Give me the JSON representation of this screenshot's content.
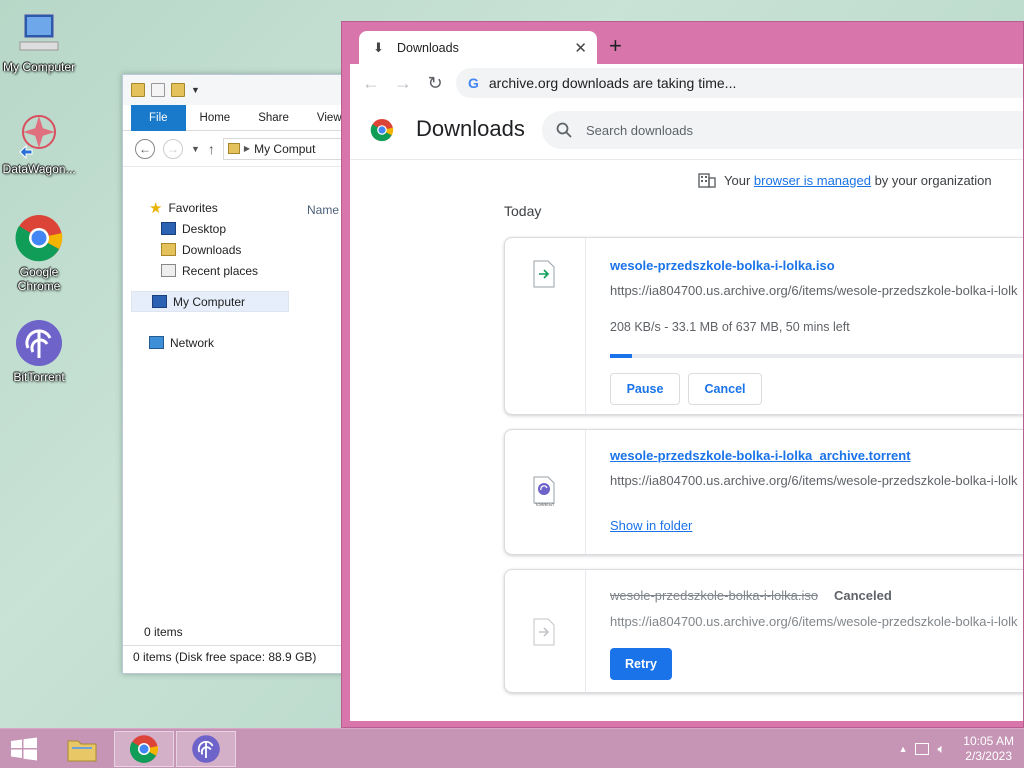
{
  "desktop": {
    "icons": [
      {
        "label": "My Computer"
      },
      {
        "label": "DataWagon..."
      },
      {
        "label": "Google Chrome"
      },
      {
        "label": "BitTorrent"
      }
    ]
  },
  "explorer": {
    "ribbon_tabs": [
      "File",
      "Home",
      "Share",
      "View"
    ],
    "address": "My Comput",
    "nav": {
      "favorites": "Favorites",
      "desktop": "Desktop",
      "downloads": "Downloads",
      "recent": "Recent places",
      "my_computer": "My Computer",
      "network": "Network"
    },
    "column_name": "Name",
    "status_count": "0 items",
    "status_free": "0 items (Disk free space: 88.9 GB)"
  },
  "chrome": {
    "tab_title": "Downloads",
    "omnibox_text": "archive.org downloads are taking time...",
    "page_title": "Downloads",
    "search_placeholder": "Search downloads",
    "managed": {
      "prefix": "Your ",
      "link": "browser is managed",
      "suffix": " by your organization"
    },
    "section": "Today",
    "downloads": [
      {
        "name": "wesole-przedszkole-bolka-i-lolka.iso",
        "url": "https://ia804700.us.archive.org/6/items/wesole-przedszkole-bolka-i-lolk",
        "progress_text": "208 KB/s - 33.1 MB of 637 MB, 50 mins left",
        "progress_fraction": 0.052,
        "pause": "Pause",
        "cancel": "Cancel"
      },
      {
        "name": "wesole-przedszkole-bolka-i-lolka_archive.torrent",
        "url": "https://ia804700.us.archive.org/6/items/wesole-przedszkole-bolka-i-lolk",
        "icon_label": "TORRENT",
        "show_in_folder": "Show in folder"
      },
      {
        "name": "wesole-przedszkole-bolka-i-lolka.iso",
        "status": "Canceled",
        "url": "https://ia804700.us.archive.org/6/items/wesole-przedszkole-bolka-i-lolk",
        "retry": "Retry"
      }
    ]
  },
  "taskbar": {
    "time": "10:05 AM",
    "date": "2/3/2023"
  },
  "colors": {
    "chrome_frame": "#d875aa",
    "accent": "#1a73e8",
    "taskbar": "#c695b6"
  }
}
